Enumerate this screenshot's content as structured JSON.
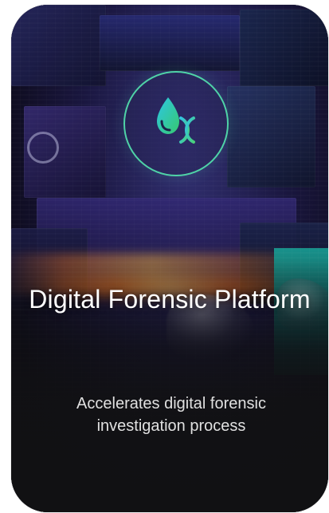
{
  "card": {
    "title": "Digital Forensic Platform",
    "description": "Accelerates digital forensic investigation process",
    "icon_name": "forensic-drop-dna-icon"
  },
  "colors": {
    "accent": "#4fd3a7",
    "title": "#ffffff",
    "description": "#e0e0e0",
    "background": "#111113"
  }
}
